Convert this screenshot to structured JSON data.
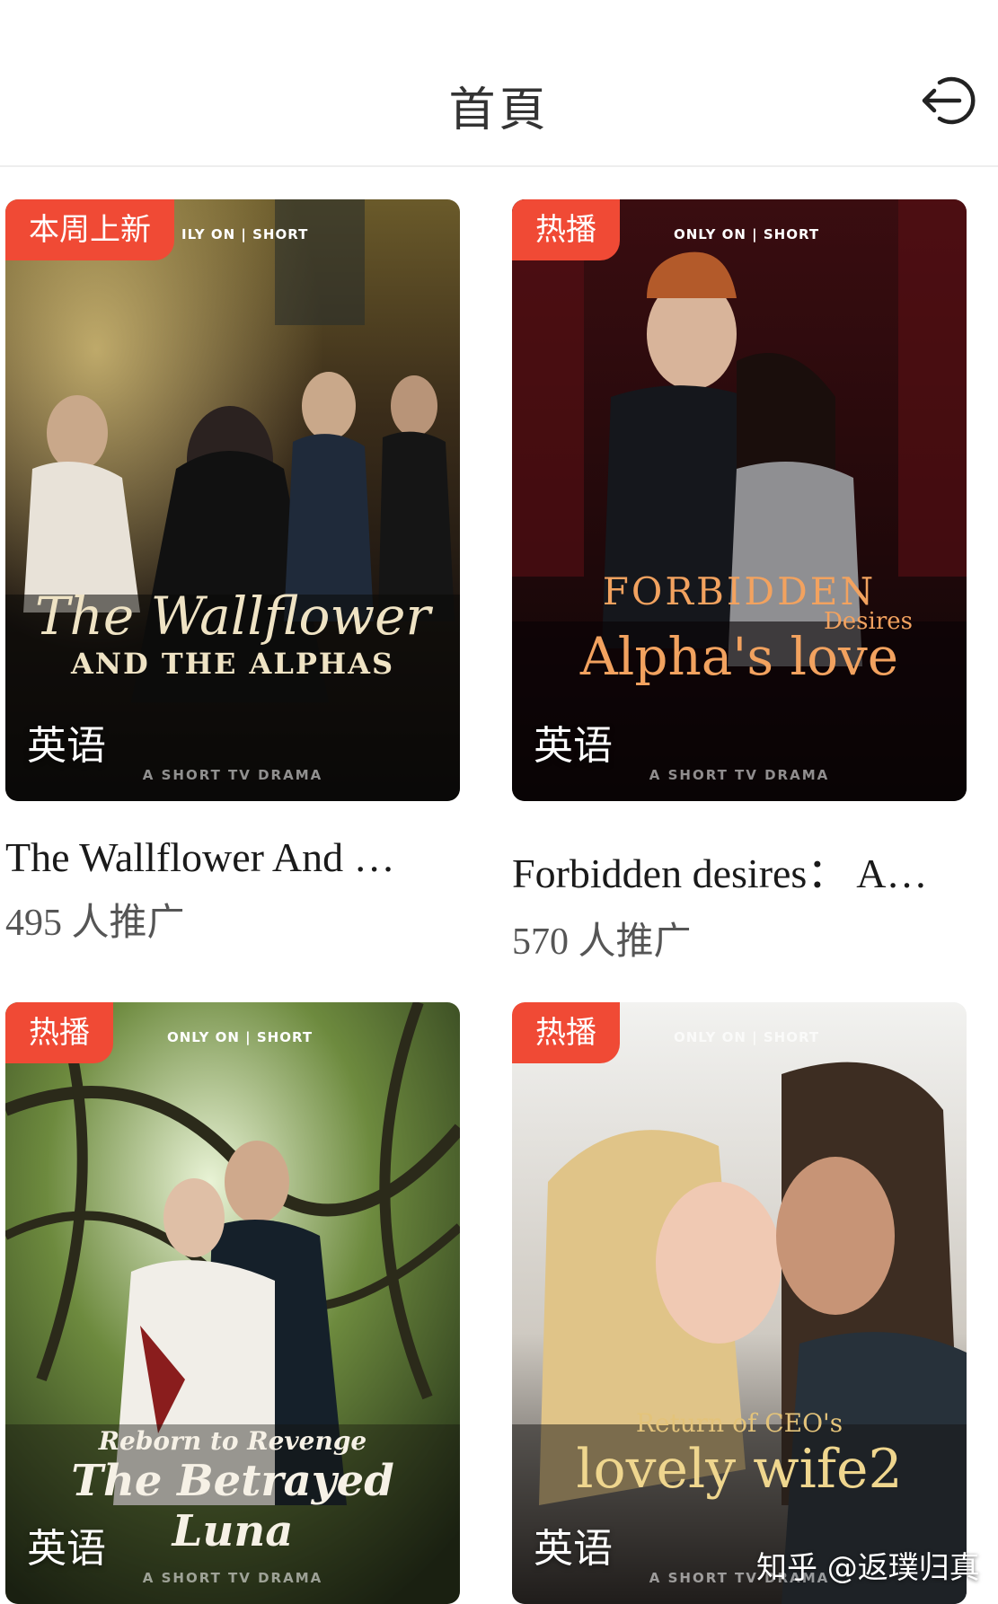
{
  "header": {
    "title": "首頁",
    "logout_icon": "logout-arrow-icon"
  },
  "cards": [
    {
      "badge": "本周上新",
      "brand": "ILY ON | SHORT",
      "poster_title_line1": "The Wallflower",
      "poster_title_line2": "AND THE ALPHAS",
      "language": "英语",
      "footer": "A SHORT TV DRAMA",
      "name": "The Wallflower And …",
      "count": "495 人推广"
    },
    {
      "badge": "热播",
      "brand": "ONLY ON | SHORT",
      "poster_title_line1": "FORBIDDEN",
      "poster_title_line2": "Alpha's love",
      "poster_title_line3": "Desires",
      "language": "英语",
      "footer": "A SHORT TV DRAMA",
      "name": "Forbidden desires： A…",
      "count": "570 人推广"
    },
    {
      "badge": "热播",
      "brand": "ONLY ON | SHORT",
      "poster_title_line1": "Reborn to Revenge",
      "poster_title_line2": "The Betrayed Luna",
      "language": "英语",
      "footer": "A SHORT TV DRAMA"
    },
    {
      "badge": "热播",
      "brand": "ONLY ON | SHORT",
      "poster_title_line1": "Return of CEO's",
      "poster_title_line2": "lovely wife2",
      "language": "英语",
      "footer": "A SHORT TV DRAMA"
    }
  ],
  "watermark": "知乎 @返璞归真",
  "colors": {
    "badge": "#f04a35",
    "background": "#ffffff"
  }
}
